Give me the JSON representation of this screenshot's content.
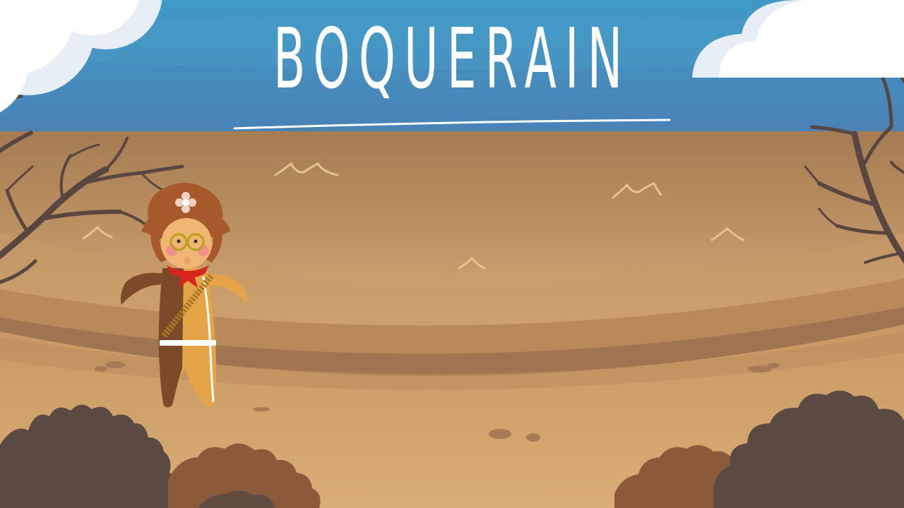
{
  "game": {
    "title": "BOQUERAIN"
  },
  "colors": {
    "sky_top": "#3f93c3",
    "sky_bottom": "#4a7fb4",
    "ground": "#c79a64",
    "ground_dark": "#a07650",
    "bush_dark": "#5b4a42",
    "bush_mid": "#8a5a3a",
    "tree": "#5a4640",
    "title_text": "#ffffff"
  },
  "character": {
    "hat_icon": "flower-icon",
    "accessories": [
      "glasses-icon",
      "bandana-icon",
      "bandolier-icon"
    ]
  }
}
